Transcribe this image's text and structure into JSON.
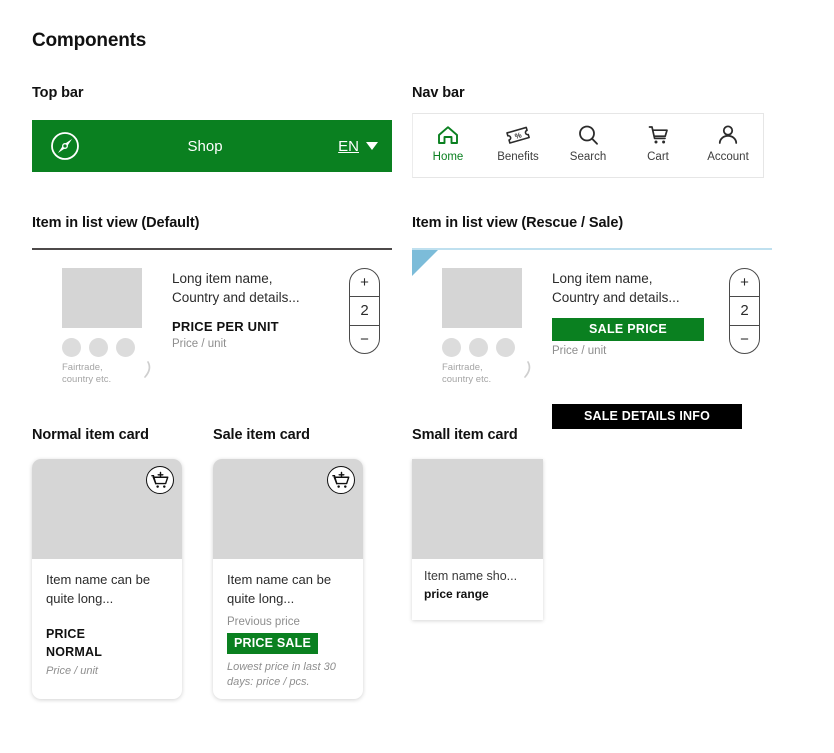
{
  "page": {
    "title": "Components",
    "brand_green": "#0a8020",
    "sale_blue": "#7cbcd9",
    "black": "#000000"
  },
  "sections": {
    "top_bar": "Top bar",
    "nav_bar": "Nav bar",
    "list_default": "Item in list view (Default)",
    "list_sale": "Item in list view (Rescue / Sale)",
    "normal_card": "Normal item card",
    "sale_card": "Sale item card",
    "small_card": "Small item card"
  },
  "top_bar": {
    "logo_icon": "compass-logo-icon",
    "shop_label": "Shop",
    "language_code": "EN",
    "caret_icon": "chevron-down-icon"
  },
  "nav_bar": {
    "items": [
      {
        "label": "Home",
        "icon": "home-icon",
        "active": true
      },
      {
        "label": "Benefits",
        "icon": "ticket-percent-icon",
        "active": false
      },
      {
        "label": "Search",
        "icon": "search-icon",
        "active": false
      },
      {
        "label": "Cart",
        "icon": "cart-icon",
        "active": false
      },
      {
        "label": "Account",
        "icon": "person-icon",
        "active": false
      }
    ]
  },
  "list_default": {
    "item_name": "Long item name,\nCountry and details...",
    "price_label": "PRICE PER UNIT",
    "price_unit": "Price / unit",
    "badges_caption": "Fairtrade,\ncountry etc.",
    "stepper": {
      "plus": "+",
      "value": "2",
      "minus": "−"
    }
  },
  "list_sale": {
    "item_name": "Long item name,\nCountry and details...",
    "sale_price_label": "SALE PRICE",
    "price_unit": "Price / unit",
    "sale_details_label": "SALE DETAILS INFO",
    "badges_caption": "Fairtrade,\ncountry etc.",
    "stepper": {
      "plus": "+",
      "value": "2",
      "minus": "−"
    }
  },
  "normal_card": {
    "item_name": "Item name can be quite long...",
    "price_label": "PRICE\nNORMAL",
    "price_unit": "Price / unit",
    "cart_icon": "add-to-cart-icon"
  },
  "sale_card": {
    "item_name": "Item name can be quite long...",
    "previous_price_label": "Previous price",
    "sale_chip_label": "PRICE SALE",
    "lowest_price_note": "Lowest price in last 30 days: price / pcs.",
    "cart_icon": "add-to-cart-icon"
  },
  "small_card": {
    "item_name": "Item name sho...",
    "price_label": "price range"
  }
}
